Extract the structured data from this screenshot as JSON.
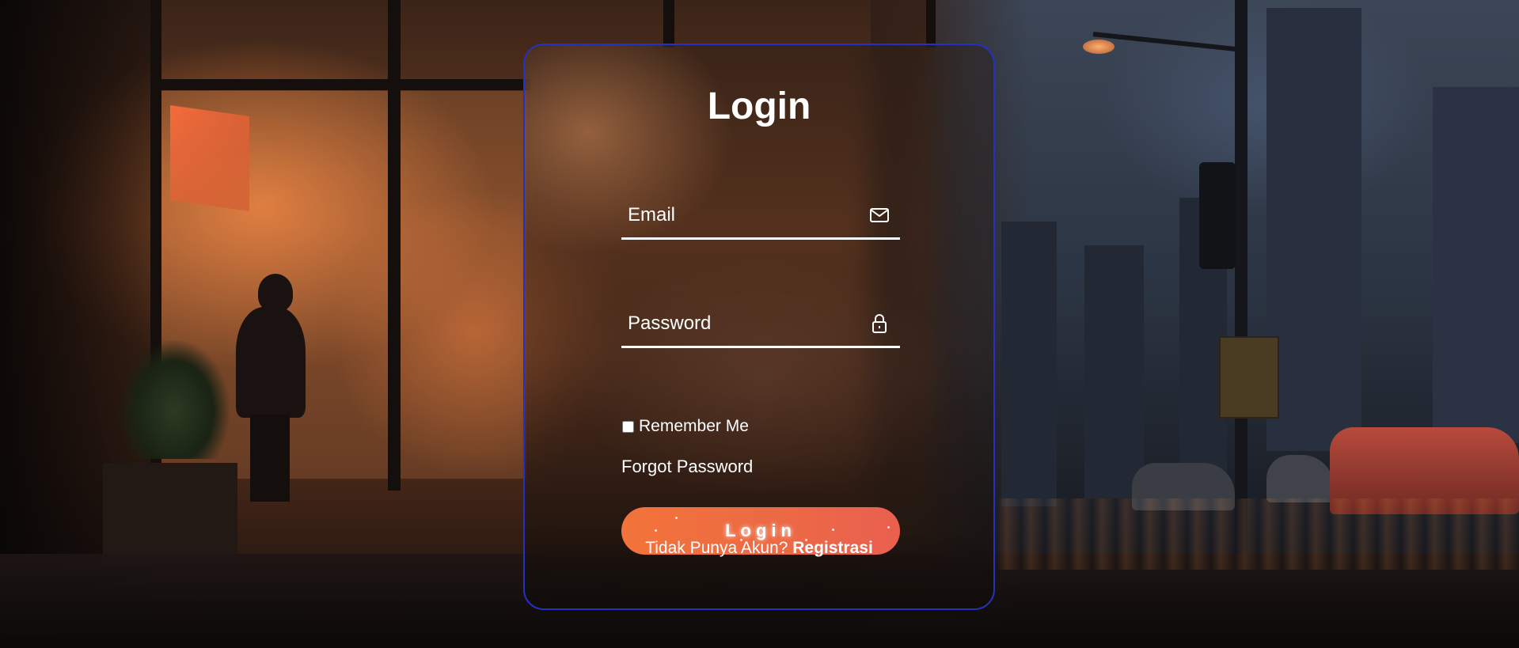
{
  "login_form": {
    "title": "Login",
    "email": {
      "placeholder": "Email",
      "value": "",
      "icon": "envelope-icon"
    },
    "password": {
      "placeholder": "Password",
      "value": "",
      "icon": "lock-icon"
    },
    "remember_me": {
      "label": "Remember Me",
      "checked": false
    },
    "forgot_password_label": "Forgot Password",
    "submit_label": "Login",
    "register_prompt": "Tidak Punya Akun?",
    "register_link_label": "Registrasi"
  },
  "colors": {
    "card_border": "#2631c4",
    "button_gradient_start": "#f3733a",
    "button_gradient_end": "#e9604f",
    "text": "#ffffff"
  }
}
